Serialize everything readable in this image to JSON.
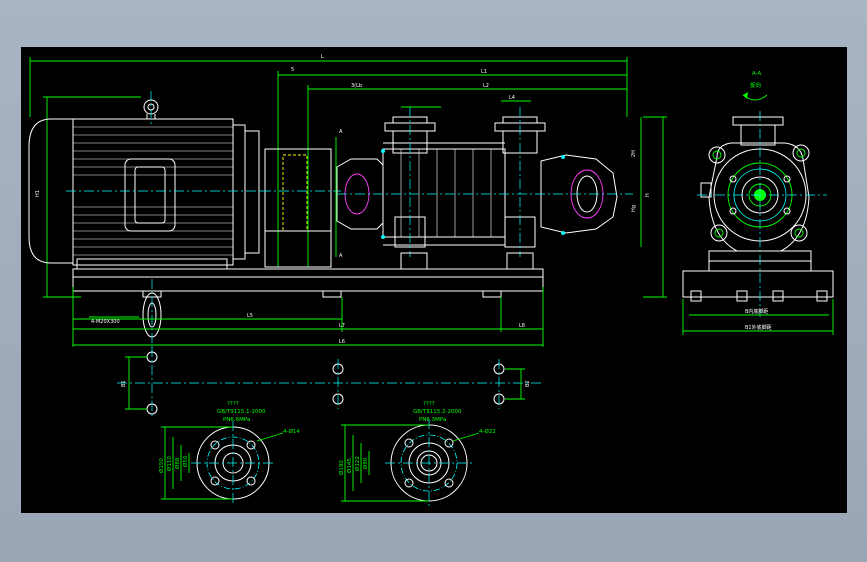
{
  "drawing": {
    "dimensions": {
      "overall_length": "L",
      "l5": "5",
      "l1": "L1",
      "l3_pos": "3(Lb",
      "l2": "L2",
      "l4": "L4",
      "l7": "L7",
      "l6_label": "L6",
      "l5_base": "L5",
      "h1": "H1",
      "h": "H",
      "h2": "2H",
      "hg": "Hg",
      "a_top": "A",
      "a_bottom": "A",
      "d1": "D1",
      "d2": "D2",
      "l8": "L8",
      "l9": "L9",
      "l10": "L10",
      "s1": "S1",
      "s2": "S2",
      "foundation_bolt": "4-M20X300",
      "bh": "B1",
      "bh2": "B2",
      "d_flange1": "D1",
      "d_flange2": "D2"
    },
    "section_view": {
      "title": "A-A",
      "subtitle": "旋向",
      "base_dim_inner": "B内底脚距",
      "base_dim_outer": "B1外底脚距"
    },
    "flange_left": {
      "code": "????",
      "standard": "GB/T9115.1-2000",
      "pressure": "PN6.6MPa",
      "holes": "4-Ø14",
      "d_outer": "Ø150",
      "d_pcd": "Ø110",
      "d_raised": "Ø88",
      "d_bore": "Ø50"
    },
    "flange_right": {
      "code": "????",
      "standard": "GB/T9115.2-2000",
      "pressure": "PN6.3MPa",
      "holes": "4-Ø22",
      "d_outer": "Ø190",
      "d_pcd": "Ø145",
      "d_raised": "Ø122",
      "d_bore": "Ø80"
    },
    "colors": {
      "background": "#000000",
      "frame": "#a7b2c0",
      "outline": "#ffffff",
      "centerline": "#00ffff",
      "dimension": "#00ff00",
      "hidden": "#ffff00",
      "accent": "#ff40ff"
    }
  }
}
